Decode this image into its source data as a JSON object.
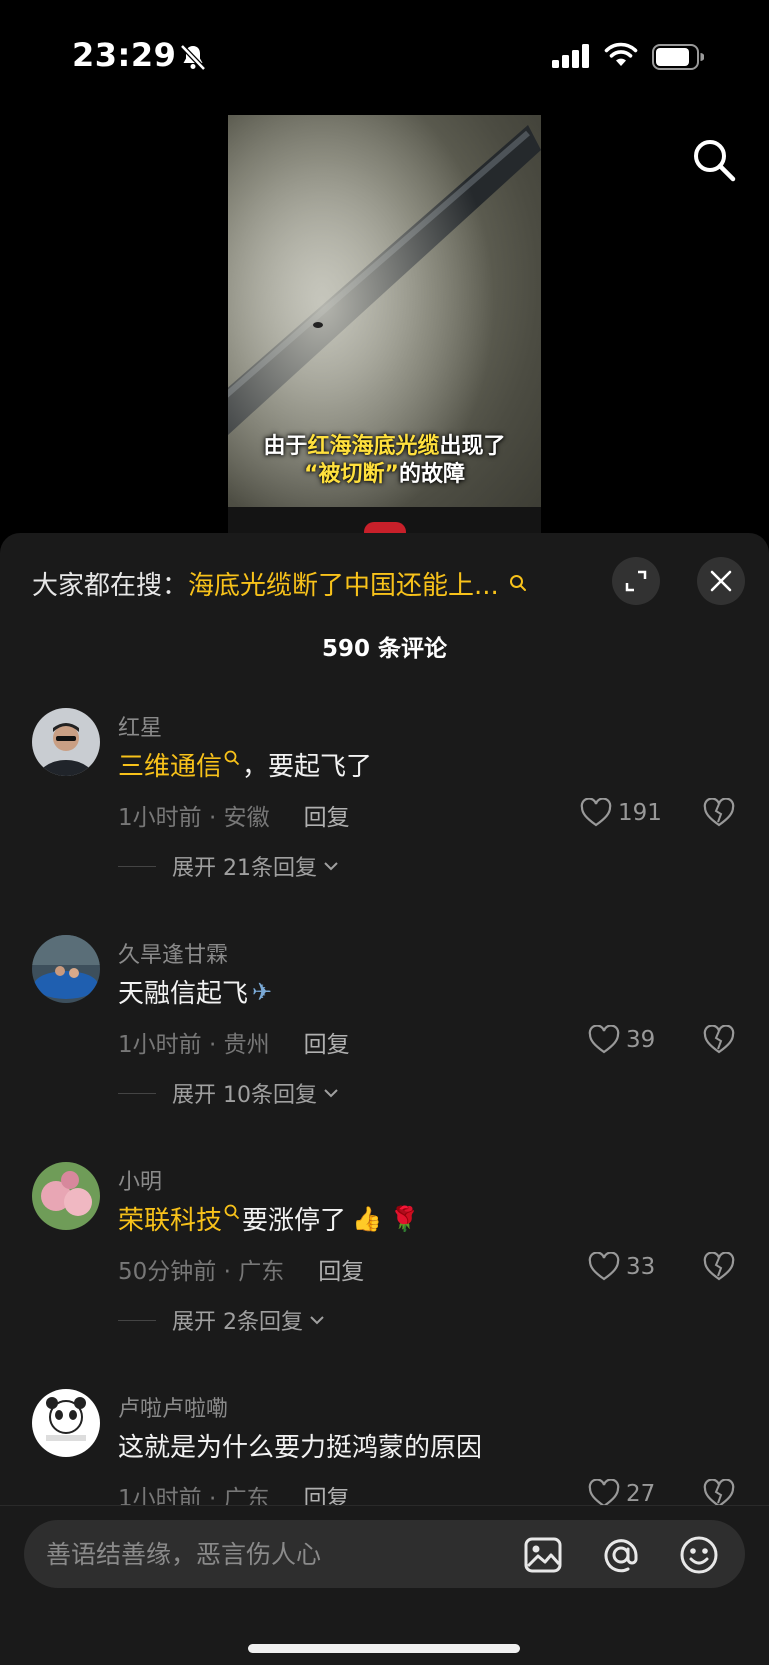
{
  "status_bar": {
    "time": "23:29"
  },
  "video": {
    "caption_line1_pre": "由于",
    "caption_line1_hl": "红海海底光缆",
    "caption_line1_post": "出现了",
    "caption_line2_hl": "“被切断”",
    "caption_line2_post": "的故障"
  },
  "panel": {
    "hot_search_prefix": "大家都在搜：",
    "hot_search_query": "海底光缆断了中国还能上...",
    "comment_count": "590 条评论"
  },
  "comments": [
    {
      "username": "红星",
      "text_highlight": "三维通信",
      "text": "，要起飞了",
      "emoji": "",
      "time_location": "1小时前 · 安徽",
      "reply": "回复",
      "likes": "191",
      "expand": "展开 21条回复"
    },
    {
      "username": "久旱逢甘霖",
      "text_highlight": "",
      "text": "天融信起飞",
      "emoji": "✈",
      "time_location": "1小时前 · 贵州",
      "reply": "回复",
      "likes": "39",
      "expand": "展开 10条回复"
    },
    {
      "username": "小明",
      "text_highlight": "荣联科技",
      "text": "要涨停了",
      "emoji": "👍 🌹",
      "time_location": "50分钟前 · 广东",
      "reply": "回复",
      "likes": "33",
      "expand": "展开 2条回复"
    },
    {
      "username": "卢啦卢啦嘞",
      "text_highlight": "",
      "text": "这就是为什么要力挺鸿蒙的原因",
      "emoji": "",
      "time_location": "1小时前 · 广东",
      "reply": "回复",
      "likes": "27",
      "expand": ""
    }
  ],
  "input": {
    "placeholder": "善语结善缘，恶言伤人心"
  },
  "colors": {
    "highlight": "#f8c21a",
    "panel_bg": "#1a1a1a"
  }
}
